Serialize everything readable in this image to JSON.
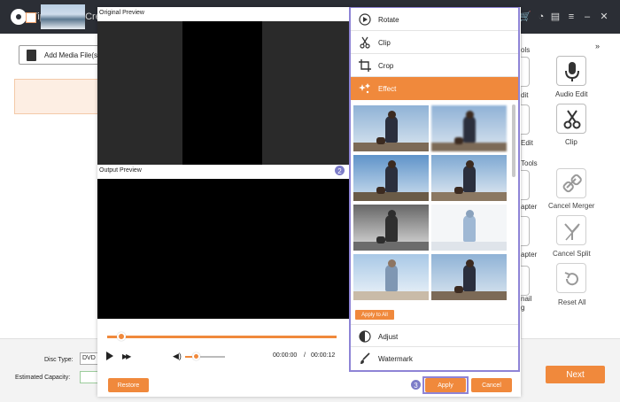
{
  "app": {
    "title": "Tipard DVD Cre"
  },
  "main": {
    "add_media_label": "Add Media File(s",
    "disc_type_label": "Disc Type:",
    "disc_type_value": "DVD",
    "estimated_capacity_label": "Estimated Capacity:",
    "next_label": "Next"
  },
  "right_panel": {
    "section1_frag": "ols",
    "section2_frag": "Tools",
    "tools": [
      {
        "label": "Audio Edit",
        "icon": "microphone-icon"
      },
      {
        "label": "Clip",
        "icon": "scissors-icon"
      },
      {
        "label": "Cancel Merger",
        "icon": "link-icon"
      },
      {
        "label": "Cancel Split",
        "icon": "split-icon"
      },
      {
        "label": "Reset All",
        "icon": "reset-icon"
      }
    ],
    "left_frags": [
      "dit",
      "Edit",
      "apter",
      "apter",
      "nail",
      "g"
    ]
  },
  "editor": {
    "original_preview_label": "Original Preview",
    "output_preview_label": "Output Preview",
    "time_current": "00:00:00",
    "time_separator": "/",
    "time_total": "00:00:12",
    "progress_fraction": 0.06,
    "volume_fraction": 0.27,
    "restore_label": "Restore",
    "apply_label": "Apply",
    "cancel_label": "Cancel",
    "badge_2": "2",
    "badge_3": "3"
  },
  "menu": {
    "items": [
      {
        "label": "Rotate",
        "icon": "rotate-icon"
      },
      {
        "label": "Clip",
        "icon": "scissors-icon"
      },
      {
        "label": "Crop",
        "icon": "crop-icon"
      },
      {
        "label": "Effect",
        "icon": "sparkle-icon",
        "active": true
      }
    ],
    "apply_to_all_label": "Apply to All",
    "bottom_items": [
      {
        "label": "Adjust",
        "icon": "adjust-icon"
      },
      {
        "label": "Watermark",
        "icon": "brush-icon"
      }
    ]
  },
  "colors": {
    "accent": "#f0893c",
    "highlight": "#8e84d6",
    "titlebar": "#2b2e35"
  }
}
